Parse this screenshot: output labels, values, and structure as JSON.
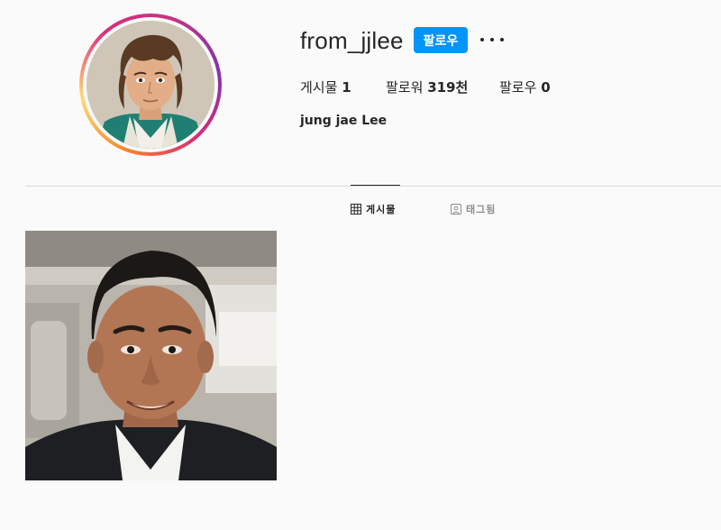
{
  "profile": {
    "username": "from_jjlee",
    "follow_label": "팔로우",
    "more_icon": "more-options-icon",
    "full_name": "jung jae Lee",
    "avatar_icon": "profile-avatar",
    "story_ring_colors": [
      "#f58529",
      "#dd2a7b",
      "#8134af"
    ]
  },
  "stats": {
    "posts_label": "게시물",
    "posts_count": "1",
    "followers_label": "팔로워",
    "followers_count": "319천",
    "following_label": "팔로우",
    "following_count": "0"
  },
  "tabs": [
    {
      "label": "게시물",
      "icon": "grid-icon",
      "active": true
    },
    {
      "label": "태그됨",
      "icon": "tagged-icon",
      "active": false
    }
  ],
  "posts": [
    {
      "icon": "post-thumbnail"
    }
  ],
  "colors": {
    "accent": "#0095f6",
    "background": "#fafafa",
    "text": "#262626",
    "muted": "#8e8e8e",
    "divider": "#dbdbdb"
  }
}
